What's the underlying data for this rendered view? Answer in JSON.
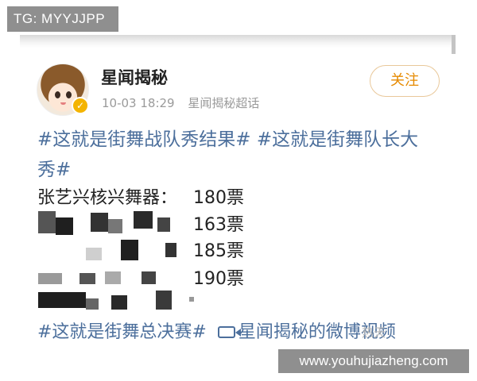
{
  "overlay": {
    "tg_label": "TG: MYYJJPP",
    "site_label": "www.youhujiazheng.com"
  },
  "post": {
    "author": "星闻揭秘",
    "timestamp": "10-03 18:29",
    "source": "星闻揭秘超话",
    "follow_label": "关注",
    "hashtag_line1": "#这就是街舞战队秀结果# #这就是街舞队长大",
    "hashtag_line2": "秀#",
    "results": [
      {
        "name": "张艺兴核兴舞器：",
        "votes": "180票"
      },
      {
        "name": "",
        "votes": "163票"
      },
      {
        "name": "",
        "votes": "185票"
      },
      {
        "name": "",
        "votes": "190票"
      }
    ],
    "bottom_hashtag": "#这就是街舞总决赛#",
    "video_link": "星闻揭秘的微博视频",
    "faint_watermark": "热天"
  },
  "colors": {
    "link": "#4c6f9c",
    "follow": "#e68a00",
    "verify": "#f4b400"
  },
  "icons": {
    "verify": "verified-badge-icon",
    "video": "video-camera-icon"
  }
}
